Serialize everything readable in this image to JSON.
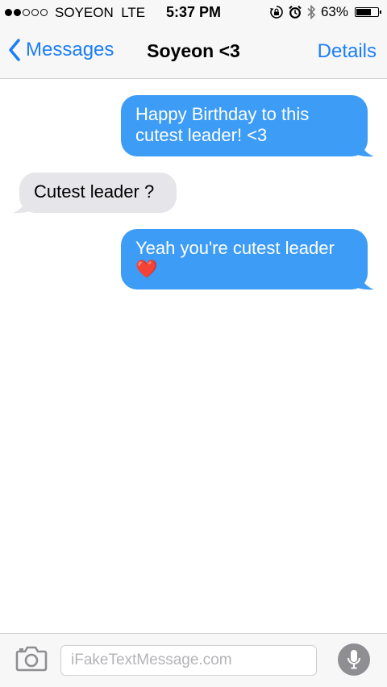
{
  "status_bar": {
    "signal_strength": "2 of 5",
    "carrier": "SOYEON",
    "network": "LTE",
    "time": "5:37 PM",
    "battery_percent": "63%",
    "battery_level": 0.63,
    "icons": [
      "rotation-lock-icon",
      "alarm-icon",
      "bluetooth-icon",
      "battery-icon"
    ]
  },
  "nav": {
    "back_label": "Messages",
    "title": "Soyeon <3",
    "details_label": "Details"
  },
  "messages": [
    {
      "direction": "sent",
      "line1": "Happy Birthday to this",
      "line2": "cutest leader! <3"
    },
    {
      "direction": "received",
      "text": "Cutest leader ?"
    },
    {
      "direction": "sent",
      "line1": "Yeah you're cutest leader",
      "emoji": "❤️"
    }
  ],
  "input": {
    "placeholder": "iFakeTextMessage.com",
    "camera_icon": "camera-icon",
    "mic_icon": "microphone-icon"
  },
  "colors": {
    "sent_bubble": "#3d9cf5",
    "received_bubble": "#e5e5ea",
    "accent": "#1a7ef7"
  }
}
